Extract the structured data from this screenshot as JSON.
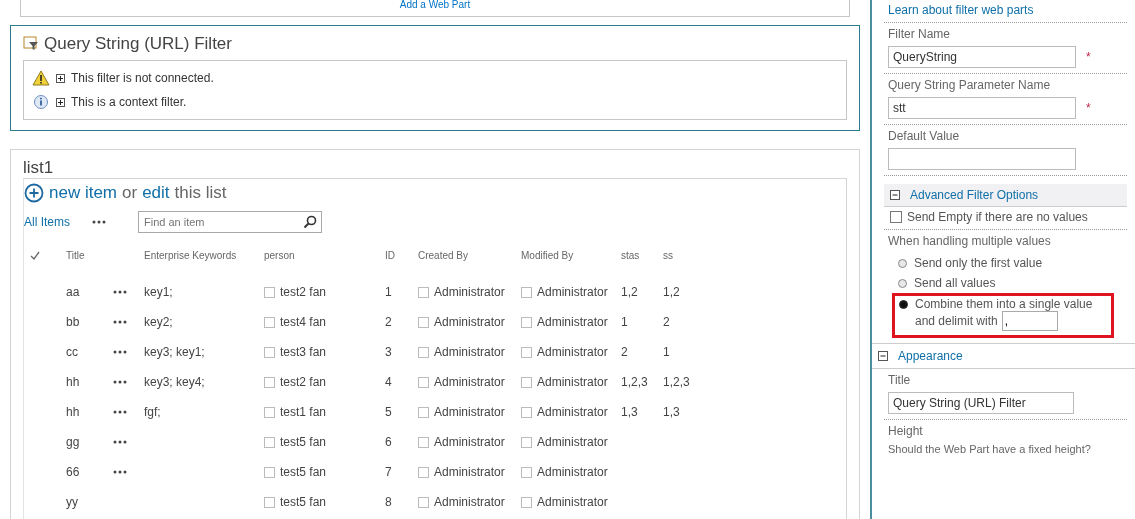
{
  "top_zone": {
    "link": "Add a Web Part"
  },
  "filter_part": {
    "title": "Query String (URL) Filter",
    "messages": [
      {
        "kind": "warning",
        "text": "This filter is not connected."
      },
      {
        "kind": "info",
        "text": "This is a context filter."
      }
    ]
  },
  "list_part": {
    "title": "list1",
    "new_item": "new item",
    "or": "or",
    "edit": "edit",
    "this_list": "this list",
    "view": "All Items",
    "search": {
      "placeholder": "Find an item"
    },
    "columns": [
      "Title",
      "Enterprise Keywords",
      "person",
      "ID",
      "Created By",
      "Modified By",
      "stas",
      "ss"
    ],
    "rows": [
      {
        "title": "aa",
        "keywords": "key1;",
        "person": "test2 fan",
        "id": "1",
        "created_by": "Administrator",
        "modified_by": "Administrator",
        "stas": "1,2",
        "ss": "1,2"
      },
      {
        "title": "bb",
        "keywords": "key2;",
        "person": "test4 fan",
        "id": "2",
        "created_by": "Administrator",
        "modified_by": "Administrator",
        "stas": "1",
        "ss": "2"
      },
      {
        "title": "cc",
        "keywords": "key3; key1;",
        "person": "test3 fan",
        "id": "3",
        "created_by": "Administrator",
        "modified_by": "Administrator",
        "stas": "2",
        "ss": "1"
      },
      {
        "title": "hh",
        "keywords": "key3; key4;",
        "person": "test2 fan",
        "id": "4",
        "created_by": "Administrator",
        "modified_by": "Administrator",
        "stas": "1,2,3",
        "ss": "1,2,3"
      },
      {
        "title": "hh",
        "keywords": "fgf;",
        "person": "test1 fan",
        "id": "5",
        "created_by": "Administrator",
        "modified_by": "Administrator",
        "stas": "1,3",
        "ss": "1,3"
      },
      {
        "title": "gg",
        "keywords": "",
        "person": "test5 fan",
        "id": "6",
        "created_by": "Administrator",
        "modified_by": "Administrator",
        "stas": "",
        "ss": ""
      },
      {
        "title": "66",
        "keywords": "",
        "person": "test5 fan",
        "id": "7",
        "created_by": "Administrator",
        "modified_by": "Administrator",
        "stas": "",
        "ss": ""
      },
      {
        "title": "yy",
        "keywords": "",
        "person": "test5 fan",
        "id": "8",
        "created_by": "Administrator",
        "modified_by": "Administrator",
        "stas": "",
        "ss": ""
      }
    ]
  },
  "tool_pane": {
    "learn_link": "Learn about filter web parts",
    "fields": [
      {
        "label": "Filter Name",
        "value": "QueryString",
        "required_mark": "*"
      },
      {
        "label": "Query String Parameter Name",
        "value": "stt",
        "required_mark": "*"
      },
      {
        "label": "Default Value"
      }
    ],
    "advanced": {
      "title": "Advanced Filter Options",
      "expanded": true,
      "send_empty": {
        "label": "Send Empty if there are no values",
        "checked": false
      },
      "multi_label": "When handling multiple values",
      "options": [
        {
          "label": "Send only the first value",
          "selected": false
        },
        {
          "label": "Send all values",
          "selected": false
        },
        {
          "label": "Combine them into a single value",
          "selected": true,
          "highlighted": true
        }
      ],
      "delimit_label": "and delimit with",
      "delimiter": ","
    },
    "appearance": {
      "title": "Appearance",
      "expanded": true,
      "title_label": "Title",
      "title_value": "Query String (URL) Filter",
      "height_label": "Height",
      "height_question": "Should the Web Part have a fixed height?"
    }
  }
}
